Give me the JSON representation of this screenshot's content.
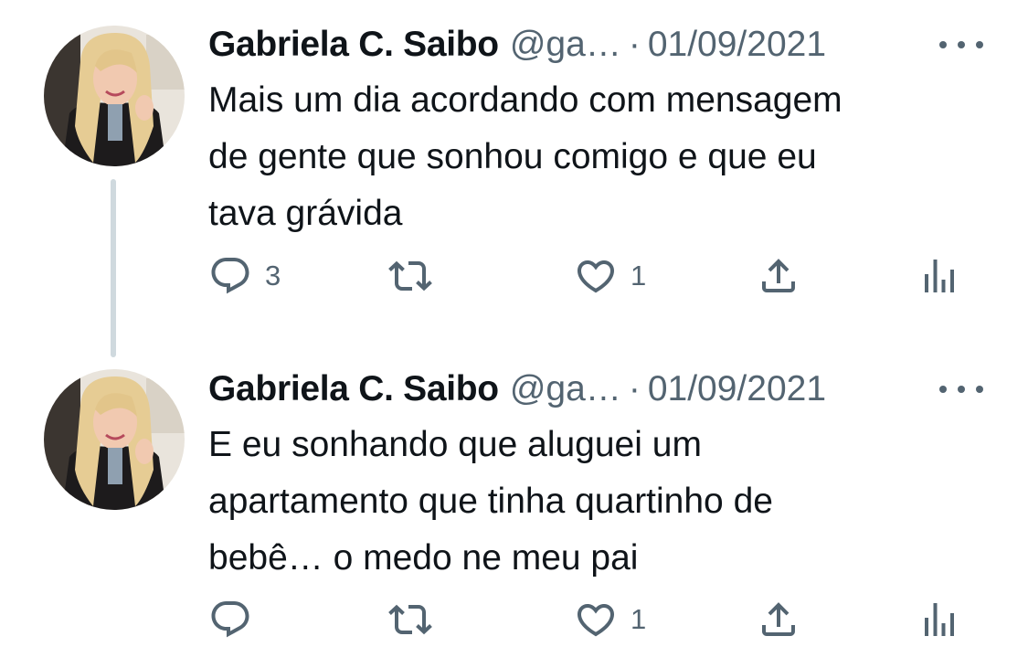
{
  "colors": {
    "text_primary": "#0f1419",
    "text_secondary": "#536471",
    "thread_line": "#cfd9de",
    "background": "#ffffff"
  },
  "tweets": [
    {
      "author": {
        "display_name": "Gabriela C. Saibo",
        "handle": "@ga…"
      },
      "separator": "·",
      "date": "01/09/2021",
      "text_lines": [
        "Mais um dia acordando com mensagem",
        "de gente que sonhou comigo e que eu",
        "tava grávida"
      ],
      "actions": {
        "reply": {
          "icon": "reply-icon",
          "count": "3"
        },
        "retweet": {
          "icon": "retweet-icon",
          "count": ""
        },
        "like": {
          "icon": "heart-icon",
          "count": "1"
        },
        "share": {
          "icon": "share-icon"
        },
        "analytics": {
          "icon": "analytics-icon"
        }
      },
      "more_icon": "more-icon"
    },
    {
      "author": {
        "display_name": "Gabriela C. Saibo",
        "handle": "@ga…"
      },
      "separator": "·",
      "date": "01/09/2021",
      "text_lines": [
        "E eu sonhando que aluguei um",
        "apartamento que tinha quartinho de",
        "bebê… o medo ne meu pai"
      ],
      "actions": {
        "reply": {
          "icon": "reply-icon",
          "count": ""
        },
        "retweet": {
          "icon": "retweet-icon",
          "count": ""
        },
        "like": {
          "icon": "heart-icon",
          "count": "1"
        },
        "share": {
          "icon": "share-icon"
        },
        "analytics": {
          "icon": "analytics-icon"
        }
      },
      "more_icon": "more-icon"
    }
  ]
}
